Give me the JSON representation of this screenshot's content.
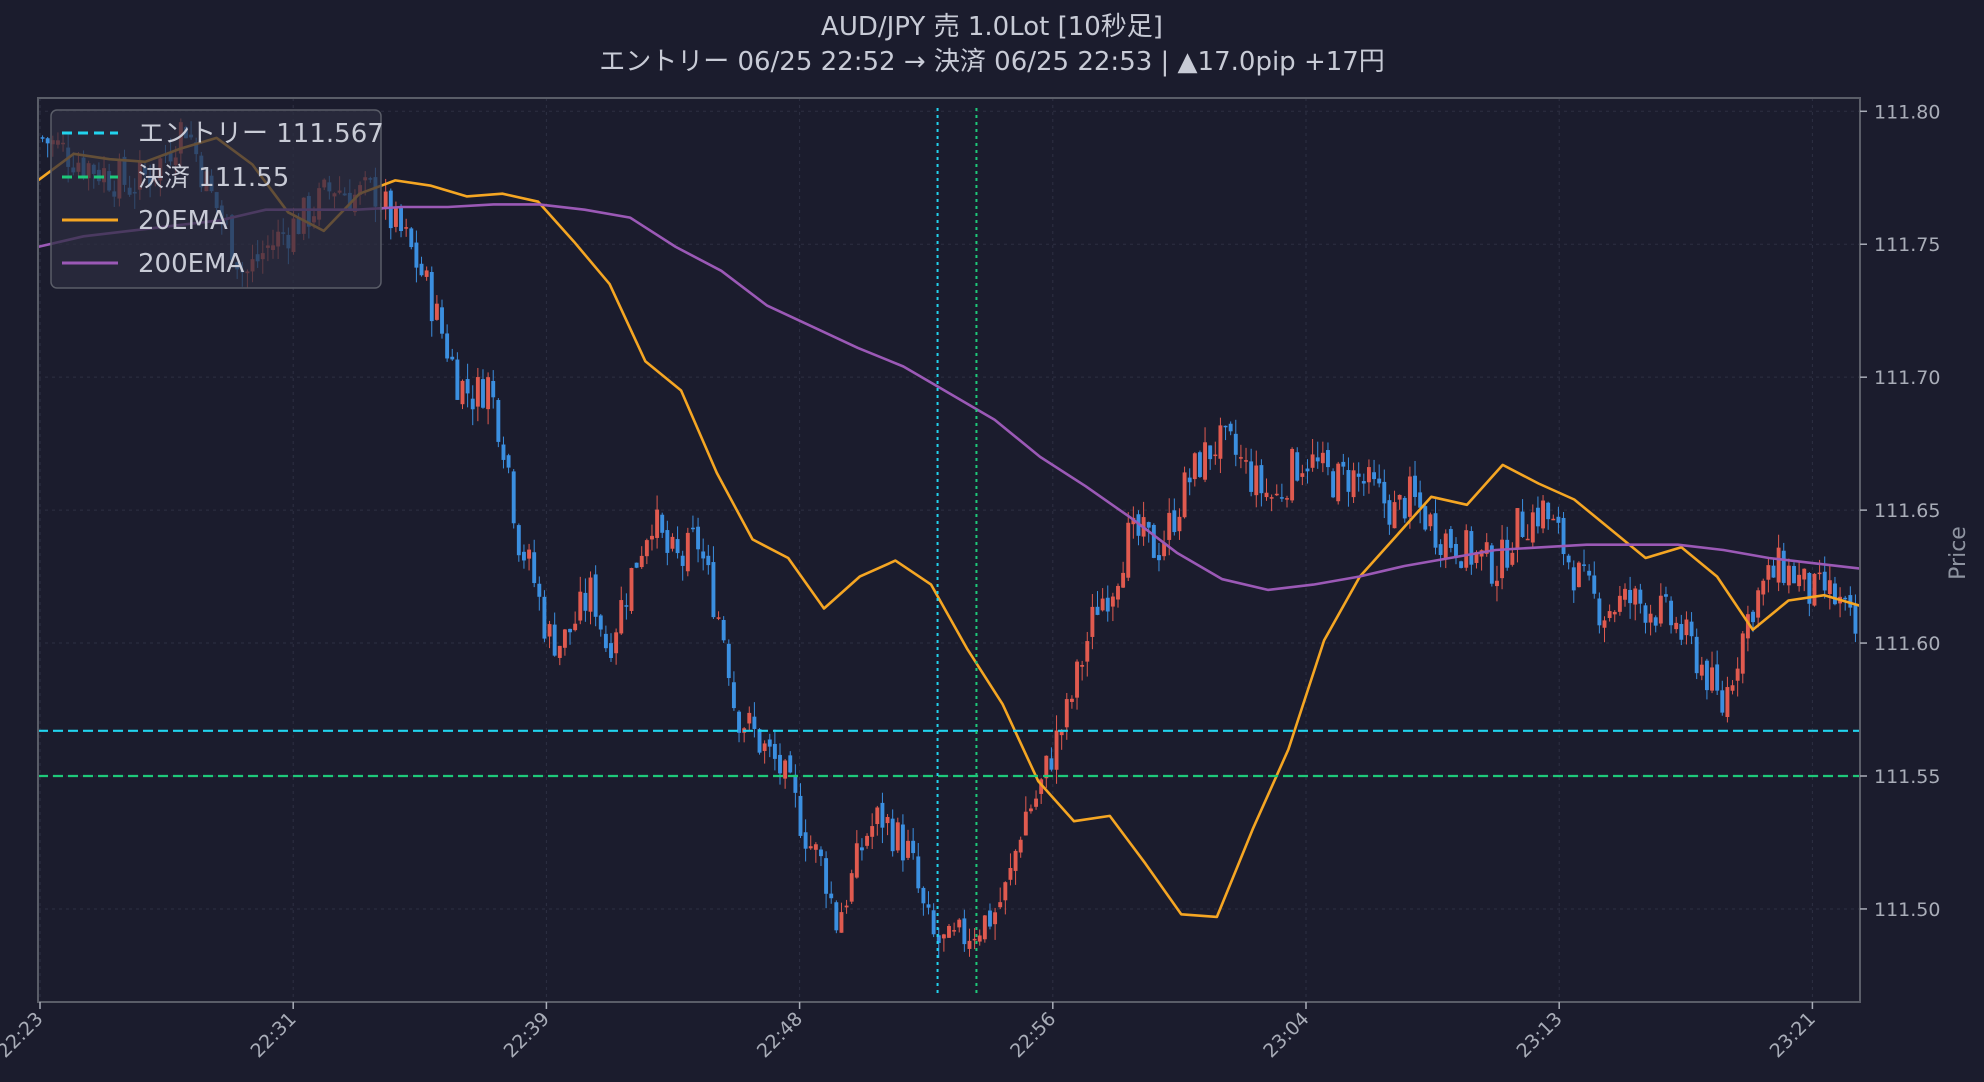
{
  "chart_data": {
    "type": "candlestick",
    "title": "AUD/JPY 売 1.0Lot [10秒足]",
    "subtitle": "エントリー 06/25 22:52 → 決済 06/25 22:53 | ▲17.0pip +17円",
    "ylabel": "Price",
    "xlabel": "",
    "ylim": [
      111.465,
      111.805
    ],
    "yticks": [
      111.5,
      111.55,
      111.6,
      111.65,
      111.7,
      111.75,
      111.8
    ],
    "ytick_labels": [
      "111.50",
      "111.55",
      "111.60",
      "111.65",
      "111.70",
      "111.75",
      "111.80"
    ],
    "xtick_labels": [
      "22:23",
      "22:31",
      "22:39",
      "22:48",
      "22:56",
      "23:04",
      "23:13",
      "23:21"
    ],
    "grid": true,
    "legend_position": "top-left",
    "entry": {
      "label": "エントリー 111.567",
      "price": 111.567,
      "time": "22:52",
      "color": "#22d3ee"
    },
    "exit": {
      "label": "決済 111.55",
      "price": 111.55,
      "time": "22:53",
      "color": "#1ec97a"
    },
    "series": [
      {
        "name": "20EMA",
        "color": "#f5a623",
        "values": [
          111.774,
          111.784,
          111.782,
          111.781,
          111.786,
          111.79,
          111.78,
          111.762,
          111.755,
          111.769,
          111.774,
          111.772,
          111.768,
          111.769,
          111.766,
          111.751,
          111.735,
          111.706,
          111.695,
          111.664,
          111.639,
          111.632,
          111.613,
          111.625,
          111.631,
          111.622,
          111.598,
          111.577,
          111.548,
          111.533,
          111.535,
          111.517,
          111.498,
          111.497,
          111.53,
          111.56,
          111.601,
          111.625,
          111.64,
          111.655,
          111.652,
          111.667,
          111.66,
          111.654,
          111.643,
          111.632,
          111.636,
          111.625,
          111.605,
          111.616,
          111.618,
          111.614
        ]
      },
      {
        "name": "200EMA",
        "color": "#9b59b6",
        "values": [
          111.749,
          111.753,
          111.755,
          111.757,
          111.759,
          111.763,
          111.763,
          111.763,
          111.764,
          111.764,
          111.765,
          111.765,
          111.763,
          111.76,
          111.749,
          111.74,
          111.727,
          111.719,
          111.711,
          111.704,
          111.694,
          111.684,
          111.67,
          111.659,
          111.647,
          111.634,
          111.624,
          111.62,
          111.622,
          111.625,
          111.629,
          111.632,
          111.635,
          111.636,
          111.637,
          111.637,
          111.637,
          111.635,
          111.632,
          111.63,
          111.628
        ]
      }
    ],
    "candles": {
      "time_start": "22:23",
      "time_end": "23:22",
      "count": 355,
      "close_path": [
        [
          0,
          111.79
        ],
        [
          15,
          111.78
        ],
        [
          30,
          111.772
        ],
        [
          38,
          111.778
        ],
        [
          48,
          111.796
        ],
        [
          56,
          111.77
        ],
        [
          62,
          111.756
        ],
        [
          68,
          111.738
        ],
        [
          75,
          111.748
        ],
        [
          82,
          111.755
        ],
        [
          90,
          111.762
        ],
        [
          98,
          111.772
        ],
        [
          105,
          111.768
        ],
        [
          112,
          111.77
        ],
        [
          118,
          111.758
        ],
        [
          122,
          111.752
        ],
        [
          128,
          111.738
        ],
        [
          135,
          111.715
        ],
        [
          140,
          111.698
        ],
        [
          145,
          111.693
        ],
        [
          150,
          111.698
        ],
        [
          156,
          111.672
        ],
        [
          160,
          111.64
        ],
        [
          165,
          111.625
        ],
        [
          170,
          111.603
        ],
        [
          175,
          111.6
        ],
        [
          180,
          111.61
        ],
        [
          185,
          111.62
        ],
        [
          190,
          111.598
        ],
        [
          195,
          111.615
        ],
        [
          200,
          111.632
        ],
        [
          205,
          111.648
        ],
        [
          210,
          111.634
        ],
        [
          215,
          111.63
        ],
        [
          220,
          111.64
        ],
        [
          225,
          111.62
        ],
        [
          230,
          111.6
        ],
        [
          233,
          111.575
        ],
        [
          238,
          111.568
        ],
        [
          243,
          111.56
        ],
        [
          248,
          111.553
        ],
        [
          253,
          111.54
        ],
        [
          258,
          111.525
        ],
        [
          263,
          111.515
        ],
        [
          267,
          111.495
        ],
        [
          272,
          111.51
        ],
        [
          277,
          111.528
        ],
        [
          282,
          111.535
        ],
        [
          287,
          111.528
        ],
        [
          292,
          111.52
        ],
        [
          296,
          111.5
        ],
        [
          300,
          111.488
        ],
        [
          305,
          111.486
        ],
        [
          310,
          111.49
        ],
        [
          315,
          111.494
        ],
        [
          320,
          111.498
        ],
        [
          325,
          111.509
        ],
        [
          330,
          111.535
        ],
        [
          335,
          111.543
        ],
        [
          340,
          111.56
        ],
        [
          345,
          111.574
        ],
        [
          350,
          111.595
        ],
        [
          355,
          111.615
        ],
        [
          360,
          111.622
        ],
        [
          365,
          111.639
        ],
        [
          370,
          111.64
        ],
        [
          375,
          111.635
        ],
        [
          380,
          111.646
        ],
        [
          385,
          111.66
        ],
        [
          390,
          111.669
        ],
        [
          395,
          111.675
        ],
        [
          400,
          111.673
        ],
        [
          405,
          111.665
        ],
        [
          410,
          111.658
        ],
        [
          415,
          111.654
        ],
        [
          420,
          111.665
        ],
        [
          425,
          111.67
        ],
        [
          430,
          111.665
        ],
        [
          435,
          111.661
        ],
        [
          440,
          111.663
        ],
        [
          445,
          111.66
        ],
        [
          450,
          111.655
        ],
        [
          455,
          111.649
        ],
        [
          460,
          111.655
        ],
        [
          465,
          111.648
        ],
        [
          470,
          111.641
        ],
        [
          475,
          111.638
        ],
        [
          480,
          111.634
        ],
        [
          485,
          111.631
        ],
        [
          490,
          111.628
        ],
        [
          495,
          111.642
        ],
        [
          500,
          111.647
        ],
        [
          505,
          111.65
        ],
        [
          510,
          111.64
        ],
        [
          515,
          111.628
        ],
        [
          520,
          111.619
        ],
        [
          525,
          111.612
        ],
        [
          530,
          111.615
        ],
        [
          535,
          111.616
        ],
        [
          540,
          111.614
        ],
        [
          545,
          111.611
        ],
        [
          550,
          111.606
        ],
        [
          555,
          111.598
        ],
        [
          560,
          111.588
        ],
        [
          565,
          111.575
        ],
        [
          570,
          111.595
        ],
        [
          575,
          111.614
        ],
        [
          580,
          111.623
        ],
        [
          585,
          111.629
        ],
        [
          590,
          111.625
        ],
        [
          595,
          111.618
        ],
        [
          600,
          111.62
        ],
        [
          605,
          111.614
        ],
        [
          610,
          111.603
        ]
      ]
    }
  }
}
